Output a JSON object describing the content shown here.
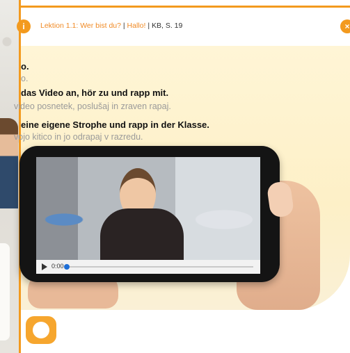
{
  "breadcrumb": {
    "lesson_link": "Lektion 1.1: Wer bist du?",
    "separator1": "|",
    "hallo": "Hallo!",
    "separator2": "|",
    "kb": "KB, S. 19"
  },
  "badge_letter": "i",
  "close_symbol": "×",
  "instructions": {
    "line1": "o.",
    "line2": "o.",
    "line3": "das Video an, hör zu und rapp mit.",
    "line4": "video posnetek, poslušaj in zraven rapaj.",
    "line5": "eine eigene Strophe und rapp in der Klasse.",
    "line6": "vojo kitico in jo odrapaj v razredu."
  },
  "video": {
    "time": "0:00",
    "progress": 0
  },
  "colors": {
    "accent": "#f39a1e",
    "panel": "#fdf0c7"
  }
}
